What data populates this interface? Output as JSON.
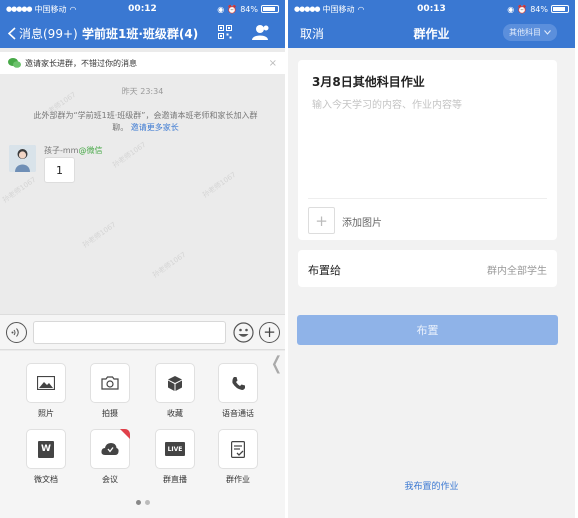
{
  "left": {
    "status": {
      "carrier": "中国移动",
      "time": "00:12",
      "battery": "84%"
    },
    "nav": {
      "back_label": "消息(99+)",
      "title": "学前班1班·班级群(4)"
    },
    "invite_banner": {
      "text": "邀请家长进群，不错过你的消息",
      "close": "×"
    },
    "chat": {
      "timestamp": "昨天 23:34",
      "system_message": "此外部群为“学前班1班·班级群”，会邀请本班老师和家长加入群聊。",
      "system_link": "邀请更多家长",
      "sender_name": "孩子-mm",
      "sender_source": "@微信",
      "message": "1"
    },
    "watermark": "孙老师1067",
    "tools": [
      {
        "label": "照片",
        "icon": "photo-icon"
      },
      {
        "label": "拍摄",
        "icon": "camera-icon"
      },
      {
        "label": "收藏",
        "icon": "favorites-icon"
      },
      {
        "label": "语音通话",
        "icon": "phone-icon"
      },
      {
        "label": "微文档",
        "icon": "doc-icon"
      },
      {
        "label": "会议",
        "icon": "meeting-icon"
      },
      {
        "label": "群直播",
        "icon": "live-icon"
      },
      {
        "label": "群作业",
        "icon": "homework-icon"
      }
    ],
    "live_badge": "LIVE",
    "doc_badge": "W"
  },
  "right": {
    "status": {
      "carrier": "中国移动",
      "time": "00:13",
      "battery": "84%"
    },
    "nav": {
      "cancel_label": "取消",
      "title": "群作业",
      "subject_dropdown": "其他科目"
    },
    "homework": {
      "title": "3月8日其他科目作业",
      "placeholder": "输入今天学习的内容、作业内容等",
      "add_image_label": "添加图片"
    },
    "assign": {
      "label": "布置给",
      "value": "群内全部学生"
    },
    "submit_label": "布置",
    "my_homework_link": "我布置的作业"
  },
  "colors": {
    "brand_blue": "#3a78d2",
    "button_disabled": "#8fb3e8",
    "badge_red": "#e0404a"
  }
}
